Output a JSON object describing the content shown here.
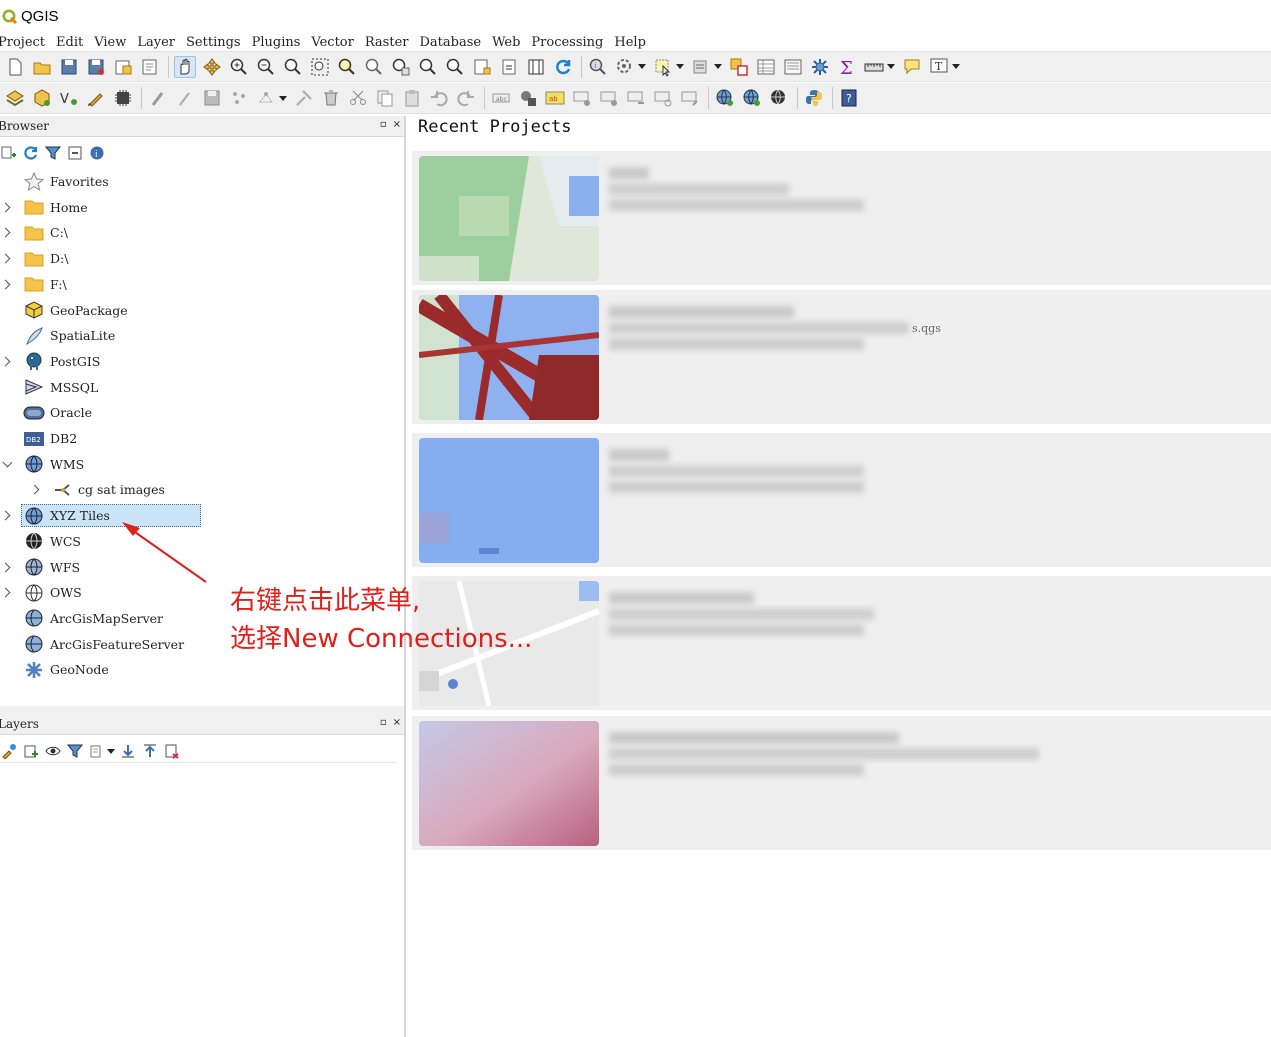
{
  "window": {
    "title": "QGIS",
    "logo_icon": "qgis-logo-icon"
  },
  "menubar": {
    "items": [
      "Project",
      "Edit",
      "View",
      "Layer",
      "Settings",
      "Plugins",
      "Vector",
      "Raster",
      "Database",
      "Web",
      "Processing",
      "Help"
    ]
  },
  "browser_panel": {
    "title": "Browser",
    "tools": [
      "add-selected-icon",
      "refresh-icon",
      "filter-icon",
      "collapse-all-icon",
      "properties-icon"
    ],
    "items": [
      {
        "label": "Favorites",
        "icon": "star-icon",
        "expander": "none"
      },
      {
        "label": "Home",
        "icon": "folder-icon",
        "expander": "collapsed"
      },
      {
        "label": "C:\\",
        "icon": "folder-icon",
        "expander": "collapsed"
      },
      {
        "label": "D:\\",
        "icon": "folder-icon",
        "expander": "collapsed"
      },
      {
        "label": "F:\\",
        "icon": "folder-icon",
        "expander": "collapsed"
      },
      {
        "label": "GeoPackage",
        "icon": "geopackage-icon",
        "expander": "none"
      },
      {
        "label": "SpatiaLite",
        "icon": "spatialite-icon",
        "expander": "none"
      },
      {
        "label": "PostGIS",
        "icon": "postgis-icon",
        "expander": "collapsed"
      },
      {
        "label": "MSSQL",
        "icon": "mssql-icon",
        "expander": "none"
      },
      {
        "label": "Oracle",
        "icon": "oracle-icon",
        "expander": "none"
      },
      {
        "label": "DB2",
        "icon": "db2-icon",
        "expander": "none"
      },
      {
        "label": "WMS",
        "icon": "wms-globe-icon",
        "expander": "expanded"
      },
      {
        "label": "cg sat images",
        "icon": "connection-icon",
        "expander": "collapsed",
        "child": true
      },
      {
        "label": "XYZ Tiles",
        "icon": "xyz-globe-icon",
        "expander": "collapsed",
        "selected": true
      },
      {
        "label": "WCS",
        "icon": "wcs-globe-icon",
        "expander": "none"
      },
      {
        "label": "WFS",
        "icon": "wfs-globe-icon",
        "expander": "collapsed"
      },
      {
        "label": "OWS",
        "icon": "ows-globe-icon",
        "expander": "collapsed"
      },
      {
        "label": "ArcGisMapServer",
        "icon": "arcgis-map-icon",
        "expander": "none"
      },
      {
        "label": "ArcGisFeatureServer",
        "icon": "arcgis-feature-icon",
        "expander": "none"
      },
      {
        "label": "GeoNode",
        "icon": "geonode-icon",
        "expander": "none"
      }
    ]
  },
  "layers_panel": {
    "title": "Layers",
    "tools": [
      "style-icon",
      "add-group-icon",
      "visibility-icon",
      "filter-icon",
      "filter-legend-icon",
      "expand-all-icon",
      "collapse-all-icon",
      "remove-layer-icon"
    ]
  },
  "panel_buttons": {
    "float": "▫",
    "close": "×"
  },
  "recent_projects": {
    "title": "Recent Projects",
    "projects": [
      {
        "thumb": "map-thumbnail-green",
        "visible_text": ""
      },
      {
        "thumb": "map-thumbnail-roads",
        "visible_text": "s.qgs"
      },
      {
        "thumb": "map-thumbnail-blue",
        "visible_text": ""
      },
      {
        "thumb": "map-thumbnail-street",
        "visible_text": ""
      },
      {
        "thumb": "map-thumbnail-gradient",
        "visible_text": ""
      }
    ]
  },
  "annotation": {
    "line1": "右键点击此菜单,",
    "line2": "选择New Connections...",
    "color": "#e0201b"
  },
  "colors": {
    "toolbar_bg": "#f0f0f0",
    "selection_bg": "#cce4f7",
    "card_bg": "#efefef",
    "annotation_red": "#e0201b"
  }
}
